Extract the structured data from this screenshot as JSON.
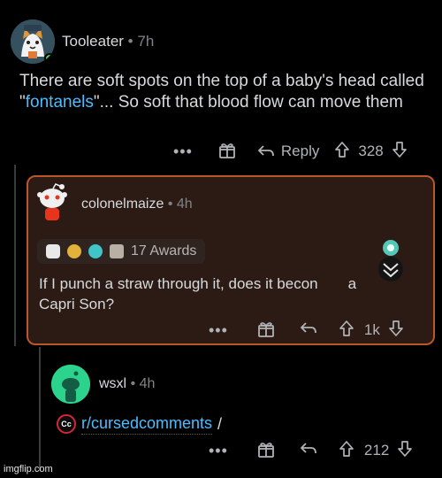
{
  "comments": [
    {
      "username": "Tooleater",
      "time": "7h",
      "body_pre": "There are soft spots on the top of a baby's head called \"",
      "body_link": "fontanels",
      "body_post": "\"... So soft that blood flow can move them",
      "actions": {
        "more": "•••",
        "reply": "Reply",
        "score": "328"
      }
    },
    {
      "username": "colonelmaize",
      "time": "4h",
      "awards_label": "17 Awards",
      "body": "If I punch a straw through it, does it becon…a Capri Son?",
      "body_line1": "If I punch a straw through it, does it becon",
      "body_line1_tail": "a",
      "body_line2": "Capri Son?",
      "actions": {
        "more": "•••",
        "score": "1k"
      }
    },
    {
      "username": "wsxl",
      "time": "4h",
      "subreddit_icon_text": "Cc",
      "subreddit": "r/cursedcomments",
      "trailing": "/",
      "actions": {
        "more": "•••",
        "score": "212"
      }
    }
  ],
  "separator": "•",
  "watermark": "imgflip.com",
  "colors": {
    "link": "#4fbcff",
    "highlight_border": "#b9562a",
    "online": "#46d160"
  }
}
